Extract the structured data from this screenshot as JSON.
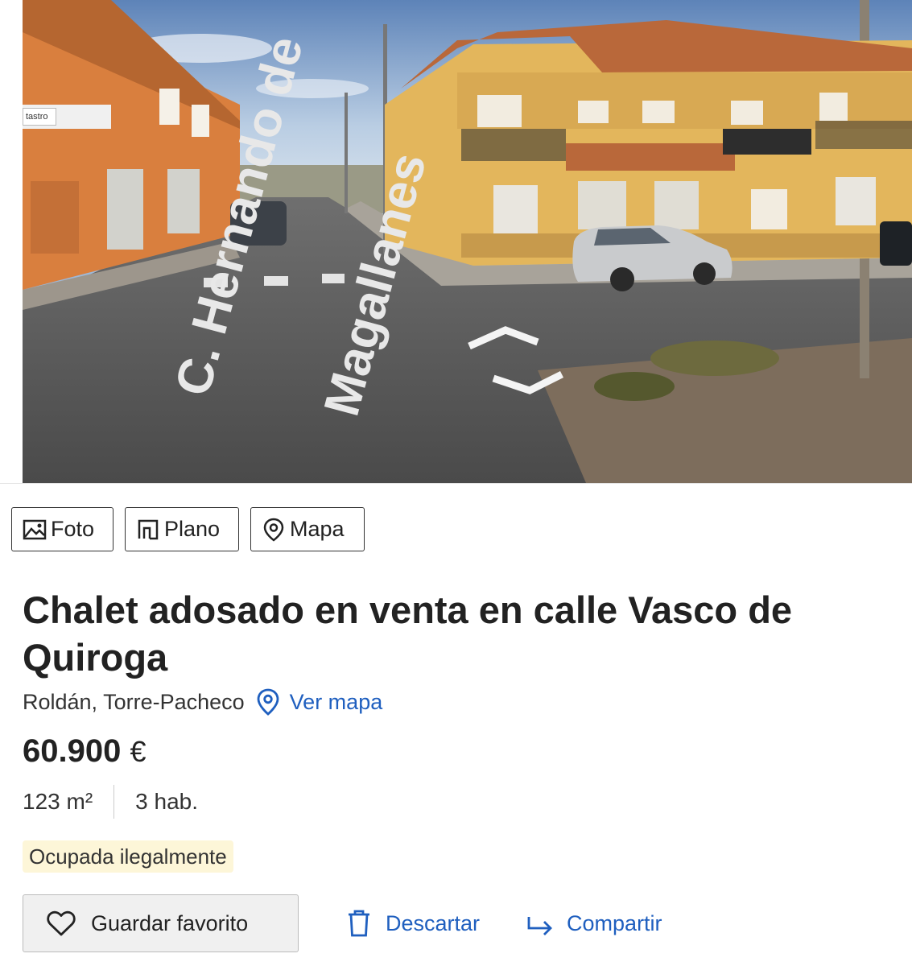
{
  "photo": {
    "overlay_tag": "tastro",
    "street_label_1": "C. Hernando de",
    "street_label_2": "Magallanes"
  },
  "media_tabs": [
    {
      "label": "Foto",
      "icon": "image-icon"
    },
    {
      "label": "Plano",
      "icon": "floor-plan-icon"
    },
    {
      "label": "Mapa",
      "icon": "map-pin-icon"
    }
  ],
  "listing": {
    "title": "Chalet adosado en venta en calle Vasco de Quiroga",
    "location": "Roldán, Torre-Pacheco",
    "map_link": "Ver mapa",
    "price": "60.900",
    "currency": "€",
    "area": "123 m²",
    "rooms": "3 hab.",
    "status_badge": "Ocupada ilegalmente"
  },
  "actions": {
    "save_label": "Guardar favorito",
    "discard_label": "Descartar",
    "share_label": "Compartir"
  },
  "colors": {
    "link": "#1f5fbf",
    "badge_bg": "#fdf6d8",
    "text": "#222222"
  }
}
